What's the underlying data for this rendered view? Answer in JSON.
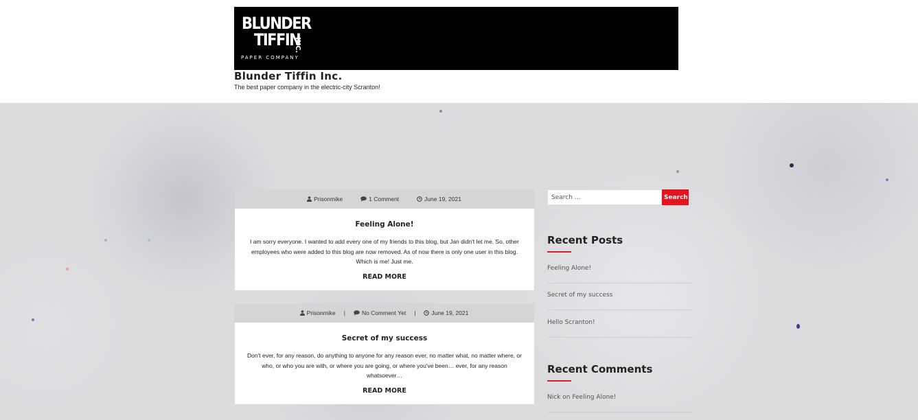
{
  "site": {
    "logo": {
      "line1": "BLUNDER",
      "line2": "TIFFIN",
      "line3": "INC.",
      "line4": "PAPER COMPANY"
    },
    "title": "Blunder Tiffin Inc.",
    "tagline": "The best paper company in the electric-city Scranton!"
  },
  "posts": [
    {
      "author": "Prisonmike",
      "comments": "1 Comment",
      "date": "June 19, 2021",
      "title": "Feeling Alone!",
      "excerpt": "I am sorry everyone. I wanted to add every one of my friends to this blog, but Jan didn't let me. So, other employees who were added to this blog are now removed. As of now there is only one user in this blog. Which is me! Just me.",
      "read_more": "READ MORE"
    },
    {
      "author": "Prisonmike",
      "comments": "No Comment Yet",
      "date": "June 19, 2021",
      "title": "Secret of my success",
      "excerpt": "Don't ever, for any reason, do anything to anyone for any reason ever, no matter what, no matter where, or who, or who you are with, or where you are going, or where you've been… ever, for any reason whatsoever…",
      "read_more": "READ MORE"
    }
  ],
  "meta_separator": "|",
  "sidebar": {
    "search": {
      "placeholder": "Search …",
      "button": "Search"
    },
    "recent_posts": {
      "title": "Recent Posts",
      "items": [
        "Feeling Alone!",
        "Secret of my success",
        "Hello Scranton!"
      ]
    },
    "recent_comments": {
      "title": "Recent Comments",
      "items": [
        "Nick on Feeling Alone!"
      ]
    }
  },
  "colors": {
    "accent": "#e4131d",
    "banner": "#000000",
    "background": "#dcdcdf"
  },
  "icons": {
    "author": "user-icon",
    "comments": "comment-icon",
    "date": "clock-icon"
  }
}
